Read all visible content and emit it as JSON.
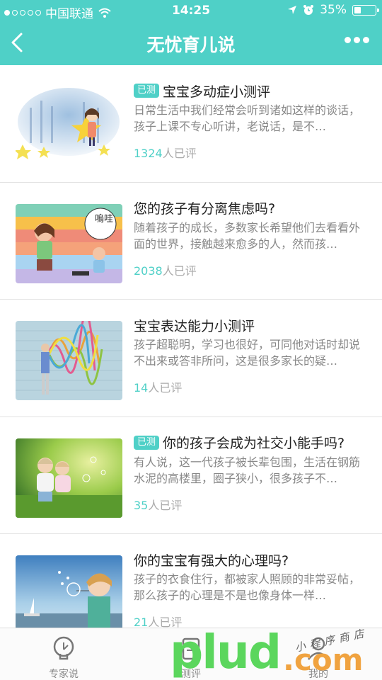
{
  "status_bar": {
    "carrier": "中国联通",
    "time": "14:25",
    "battery": "35%",
    "battery_level": 0.35
  },
  "nav": {
    "title": "无忧育儿说"
  },
  "items": [
    {
      "tag": "已测",
      "title": "宝宝多动症小测评",
      "desc": "日常生活中我们经常会听到诸如这样的谈话，孩子上课不专心听讲，老说话，是不…",
      "count": "1324",
      "count_suffix": "人已评"
    },
    {
      "tag": "",
      "title": "您的孩子有分离焦虑吗?",
      "desc": "随着孩子的成长，多数家长希望他们去看看外面的世界，接触越来愈多的人，然而孩…",
      "count": "2038",
      "count_suffix": "人已评",
      "art_text": "嗚哇"
    },
    {
      "tag": "",
      "title": "宝宝表达能力小测评",
      "desc": "孩子超聪明，学习也很好，可同他对话时却说不出来或答非所问，这是很多家长的疑…",
      "count": "14",
      "count_suffix": "人已评"
    },
    {
      "tag": "已测",
      "title": "你的孩子会成为社交小能手吗?",
      "desc": "有人说，这一代孩子被长辈包围，生活在钢筋水泥的高楼里，圈子狭小，很多孩子不…",
      "count": "35",
      "count_suffix": "人已评"
    },
    {
      "tag": "",
      "title": "你的宝宝有强大的心理吗?",
      "desc": "孩子的衣食住行，都被家人照顾的非常妥帖，那么孩子的心理是不是也像身体一样…",
      "count": "21",
      "count_suffix": "人已评"
    }
  ],
  "tabs": [
    {
      "label": "专家说",
      "icon": "lightbulb-icon"
    },
    {
      "label": "测评",
      "icon": "test-icon"
    },
    {
      "label": "我的",
      "icon": "person-icon"
    }
  ],
  "watermark": {
    "main": "plud",
    "suffix": ".com",
    "small": "小程序商店"
  },
  "colors": {
    "accent": "#4fd0c7"
  }
}
